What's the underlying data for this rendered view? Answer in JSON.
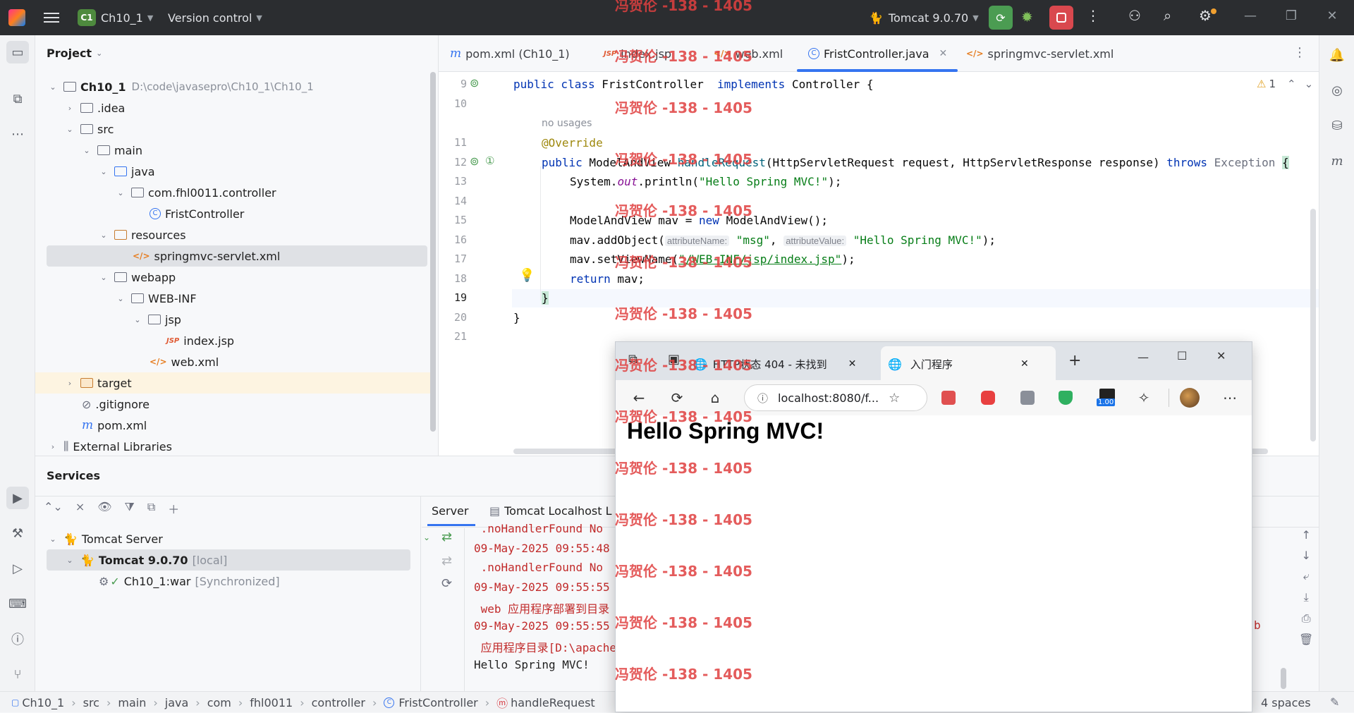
{
  "titlebar": {
    "project_badge": "C1",
    "project_name": "Ch10_1",
    "vcs": "Version control",
    "run_config": "Tomcat 9.0.70"
  },
  "project_panel": {
    "title": "Project",
    "tree": [
      {
        "label": "Ch10_1",
        "extra": "D:\\code\\javasepro\\Ch10_1\\Ch10_1"
      },
      {
        "label": ".idea"
      },
      {
        "label": "src"
      },
      {
        "label": "main"
      },
      {
        "label": "java"
      },
      {
        "label": "com.fhl0011.controller"
      },
      {
        "label": "FristController"
      },
      {
        "label": "resources"
      },
      {
        "label": "springmvc-servlet.xml"
      },
      {
        "label": "webapp"
      },
      {
        "label": "WEB-INF"
      },
      {
        "label": "jsp"
      },
      {
        "label": "index.jsp"
      },
      {
        "label": "web.xml"
      },
      {
        "label": "target"
      },
      {
        "label": ".gitignore"
      },
      {
        "label": "pom.xml"
      },
      {
        "label": "External Libraries"
      }
    ]
  },
  "editor": {
    "tabs": [
      {
        "label": "pom.xml (Ch10_1)"
      },
      {
        "label": "index.jsp"
      },
      {
        "label": "web.xml"
      },
      {
        "label": "FristController.java"
      },
      {
        "label": "springmvc-servlet.xml"
      }
    ],
    "warnings": "1",
    "line_numbers": [
      "9",
      "10",
      "11",
      "12",
      "13",
      "14",
      "15",
      "16",
      "17",
      "18",
      "19",
      "20",
      "21"
    ],
    "no_usages": "no usages",
    "code": {
      "l9_kw": "public class",
      "l9_name": " FristController  ",
      "l9_impl": "implements",
      "l9_rest": " Controller {",
      "l11": "@Override",
      "l12_kw": "public",
      "l12_a": " ModelAndView ",
      "l12_m": "handleRequest",
      "l12_b": "(HttpServletRequest request, HttpServletResponse response) ",
      "l12_throws": "throws",
      "l12_exc": " Exception ",
      "l12_brace": "{",
      "l13_a": "System.",
      "l13_out": "out",
      "l13_b": ".println(",
      "l13_str": "\"Hello Spring MVC!\"",
      "l13_c": ");",
      "l15_a": "ModelAndView mav = ",
      "l15_new": "new",
      "l15_b": " ModelAndView();",
      "l16_a": "mav.addObject(",
      "l16_h1": "attributeName:",
      "l16_s1": " \"msg\"",
      "l16_comma": ", ",
      "l16_h2": "attributeValue:",
      "l16_s2": " \"Hello Spring MVC!\"",
      "l16_end": ");",
      "l17_a": "mav.setViewName(",
      "l17_str": "\"/WEB-INF/jsp/index.jsp\"",
      "l17_b": ");",
      "l18_kw": "return",
      "l18_b": " mav;",
      "l19": "}",
      "l20": "}"
    }
  },
  "services": {
    "title": "Services",
    "tree": [
      {
        "label": "Tomcat Server"
      },
      {
        "label": "Tomcat 9.0.70",
        "extra": "[local]"
      },
      {
        "label": "Ch10_1:war",
        "extra": "[Synchronized]"
      }
    ],
    "tabs": [
      {
        "label": "Server"
      },
      {
        "label": "Tomcat Localhost L"
      }
    ],
    "log": [
      " .noHandlerFound No",
      "09-May-2025 09:55:48",
      " .noHandlerFound No",
      "09-May-2025 09:55:55",
      " web 应用程序部署到目录",
      "09-May-2025 09:55:55",
      " 应用程序目录[D:\\apache",
      "Hello Spring MVC!"
    ],
    "log_tail": "b"
  },
  "statusbar": {
    "crumbs": [
      "Ch10_1",
      "src",
      "main",
      "java",
      "com",
      "fhl0011",
      "controller",
      "FristController",
      "handleRequest"
    ],
    "indent": "4 spaces"
  },
  "browser": {
    "tabs": [
      {
        "label": "HTTP状态 404 - 未找到"
      },
      {
        "label": "入门程序"
      }
    ],
    "address": "localhost:8080/f...",
    "ext_badge": "1.00",
    "heading": "Hello Spring MVC!"
  },
  "watermark": "冯贺伦 -138 - 1405",
  "colors": {
    "accent": "#3574f0",
    "run_green": "#4b9c52",
    "stop_red": "#d9484e",
    "watermark_red": "#e04040"
  }
}
